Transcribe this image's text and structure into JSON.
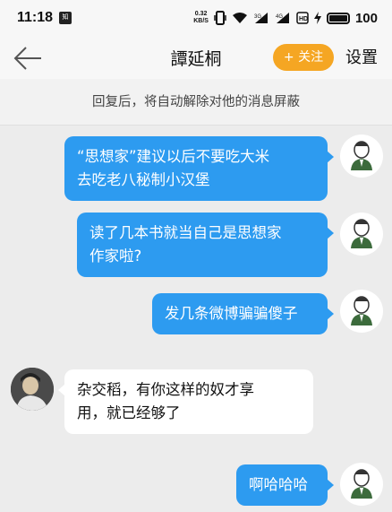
{
  "status_bar": {
    "time": "11:18",
    "notif_badge": "知",
    "net_speed_value": "0.32",
    "net_speed_unit": "KB/S",
    "battery_level": "100"
  },
  "nav": {
    "title": "譚延桐",
    "follow_label": "+ 关注",
    "settings_label": "设置"
  },
  "notice": "回复后，将自动解除对他的消息屏蔽",
  "messages": [
    {
      "sender": "me",
      "lines": [
        "“思想家”建议以后不要吃大米",
        "去吃老八秘制小汉堡"
      ]
    },
    {
      "sender": "me",
      "lines": [
        "读了几本书就当自己是思想家",
        "作家啦?"
      ]
    },
    {
      "sender": "me",
      "lines": [
        "发几条微博骗骗傻子"
      ]
    },
    {
      "sender": "other",
      "lines": [
        "杂交稻，有你这样的奴才享",
        "用，就已经够了"
      ]
    },
    {
      "sender": "me",
      "lines": [
        "啊哈哈哈"
      ]
    }
  ],
  "colors": {
    "accent_blue": "#2d9bf0",
    "follow_orange": "#f5a623"
  }
}
